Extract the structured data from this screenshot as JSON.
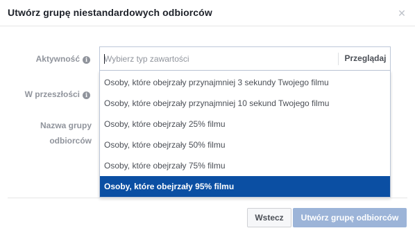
{
  "dialog": {
    "title": "Utwórz grupę niestandardowych odbiorców",
    "close_icon": "close-icon"
  },
  "form": {
    "activity_label": "Aktywność",
    "past_label": "W przeszłości",
    "audience_name_label_line1": "Nazwa grupy",
    "audience_name_label_line2": "odbiorców",
    "info_icon": "info-icon",
    "content_type": {
      "value": "",
      "placeholder": "Wybierz typ zawartości",
      "browse_label": "Przeglądaj"
    }
  },
  "dropdown": {
    "options": [
      {
        "label": "Osoby, które obejrzały przynajmniej 3 sekundy Twojego filmu",
        "selected": false
      },
      {
        "label": "Osoby, które obejrzały przynajmniej 10 sekund Twojego filmu",
        "selected": false
      },
      {
        "label": "Osoby, które obejrzały 25% filmu",
        "selected": false
      },
      {
        "label": "Osoby, które obejrzały 50% filmu",
        "selected": false
      },
      {
        "label": "Osoby, które obejrzały 75% filmu",
        "selected": false
      },
      {
        "label": "Osoby, które obejrzały 95% filmu",
        "selected": true
      }
    ]
  },
  "footer": {
    "back_label": "Wstecz",
    "create_label": "Utwórz grupę odbiorców",
    "create_disabled": true
  },
  "colors": {
    "selected_option_bg": "#0b4fa3",
    "primary_button_disabled_bg": "#9cb4d8"
  }
}
